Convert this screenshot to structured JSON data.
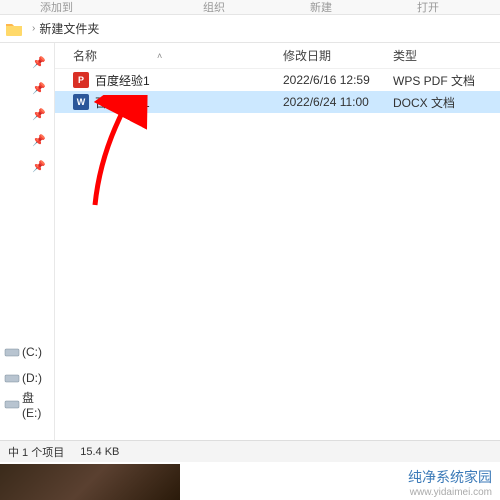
{
  "toolbar": {
    "hint1": "添加到",
    "hint2": "组织",
    "hint3": "新建",
    "hint4": "打开"
  },
  "breadcrumb": {
    "folder_name": "新建文件夹"
  },
  "columns": {
    "name": "名称",
    "date": "修改日期",
    "type": "类型"
  },
  "files": [
    {
      "icon": "pdf",
      "name": "百度经验1",
      "date": "2022/6/16 12:59",
      "type": "WPS PDF 文档"
    },
    {
      "icon": "docx",
      "name": "百度经验1",
      "date": "2022/6/24 11:00",
      "type": "DOCX 文档"
    }
  ],
  "sidebar": {
    "drives": [
      {
        "label": "(C:)"
      },
      {
        "label": "(D:)"
      },
      {
        "label": "盘 (E:)"
      }
    ]
  },
  "status": {
    "selection": "中 1 个项目",
    "size": "15.4 KB"
  },
  "watermark": {
    "title": "纯净系统家园",
    "url": "www.yidaimei.com"
  }
}
